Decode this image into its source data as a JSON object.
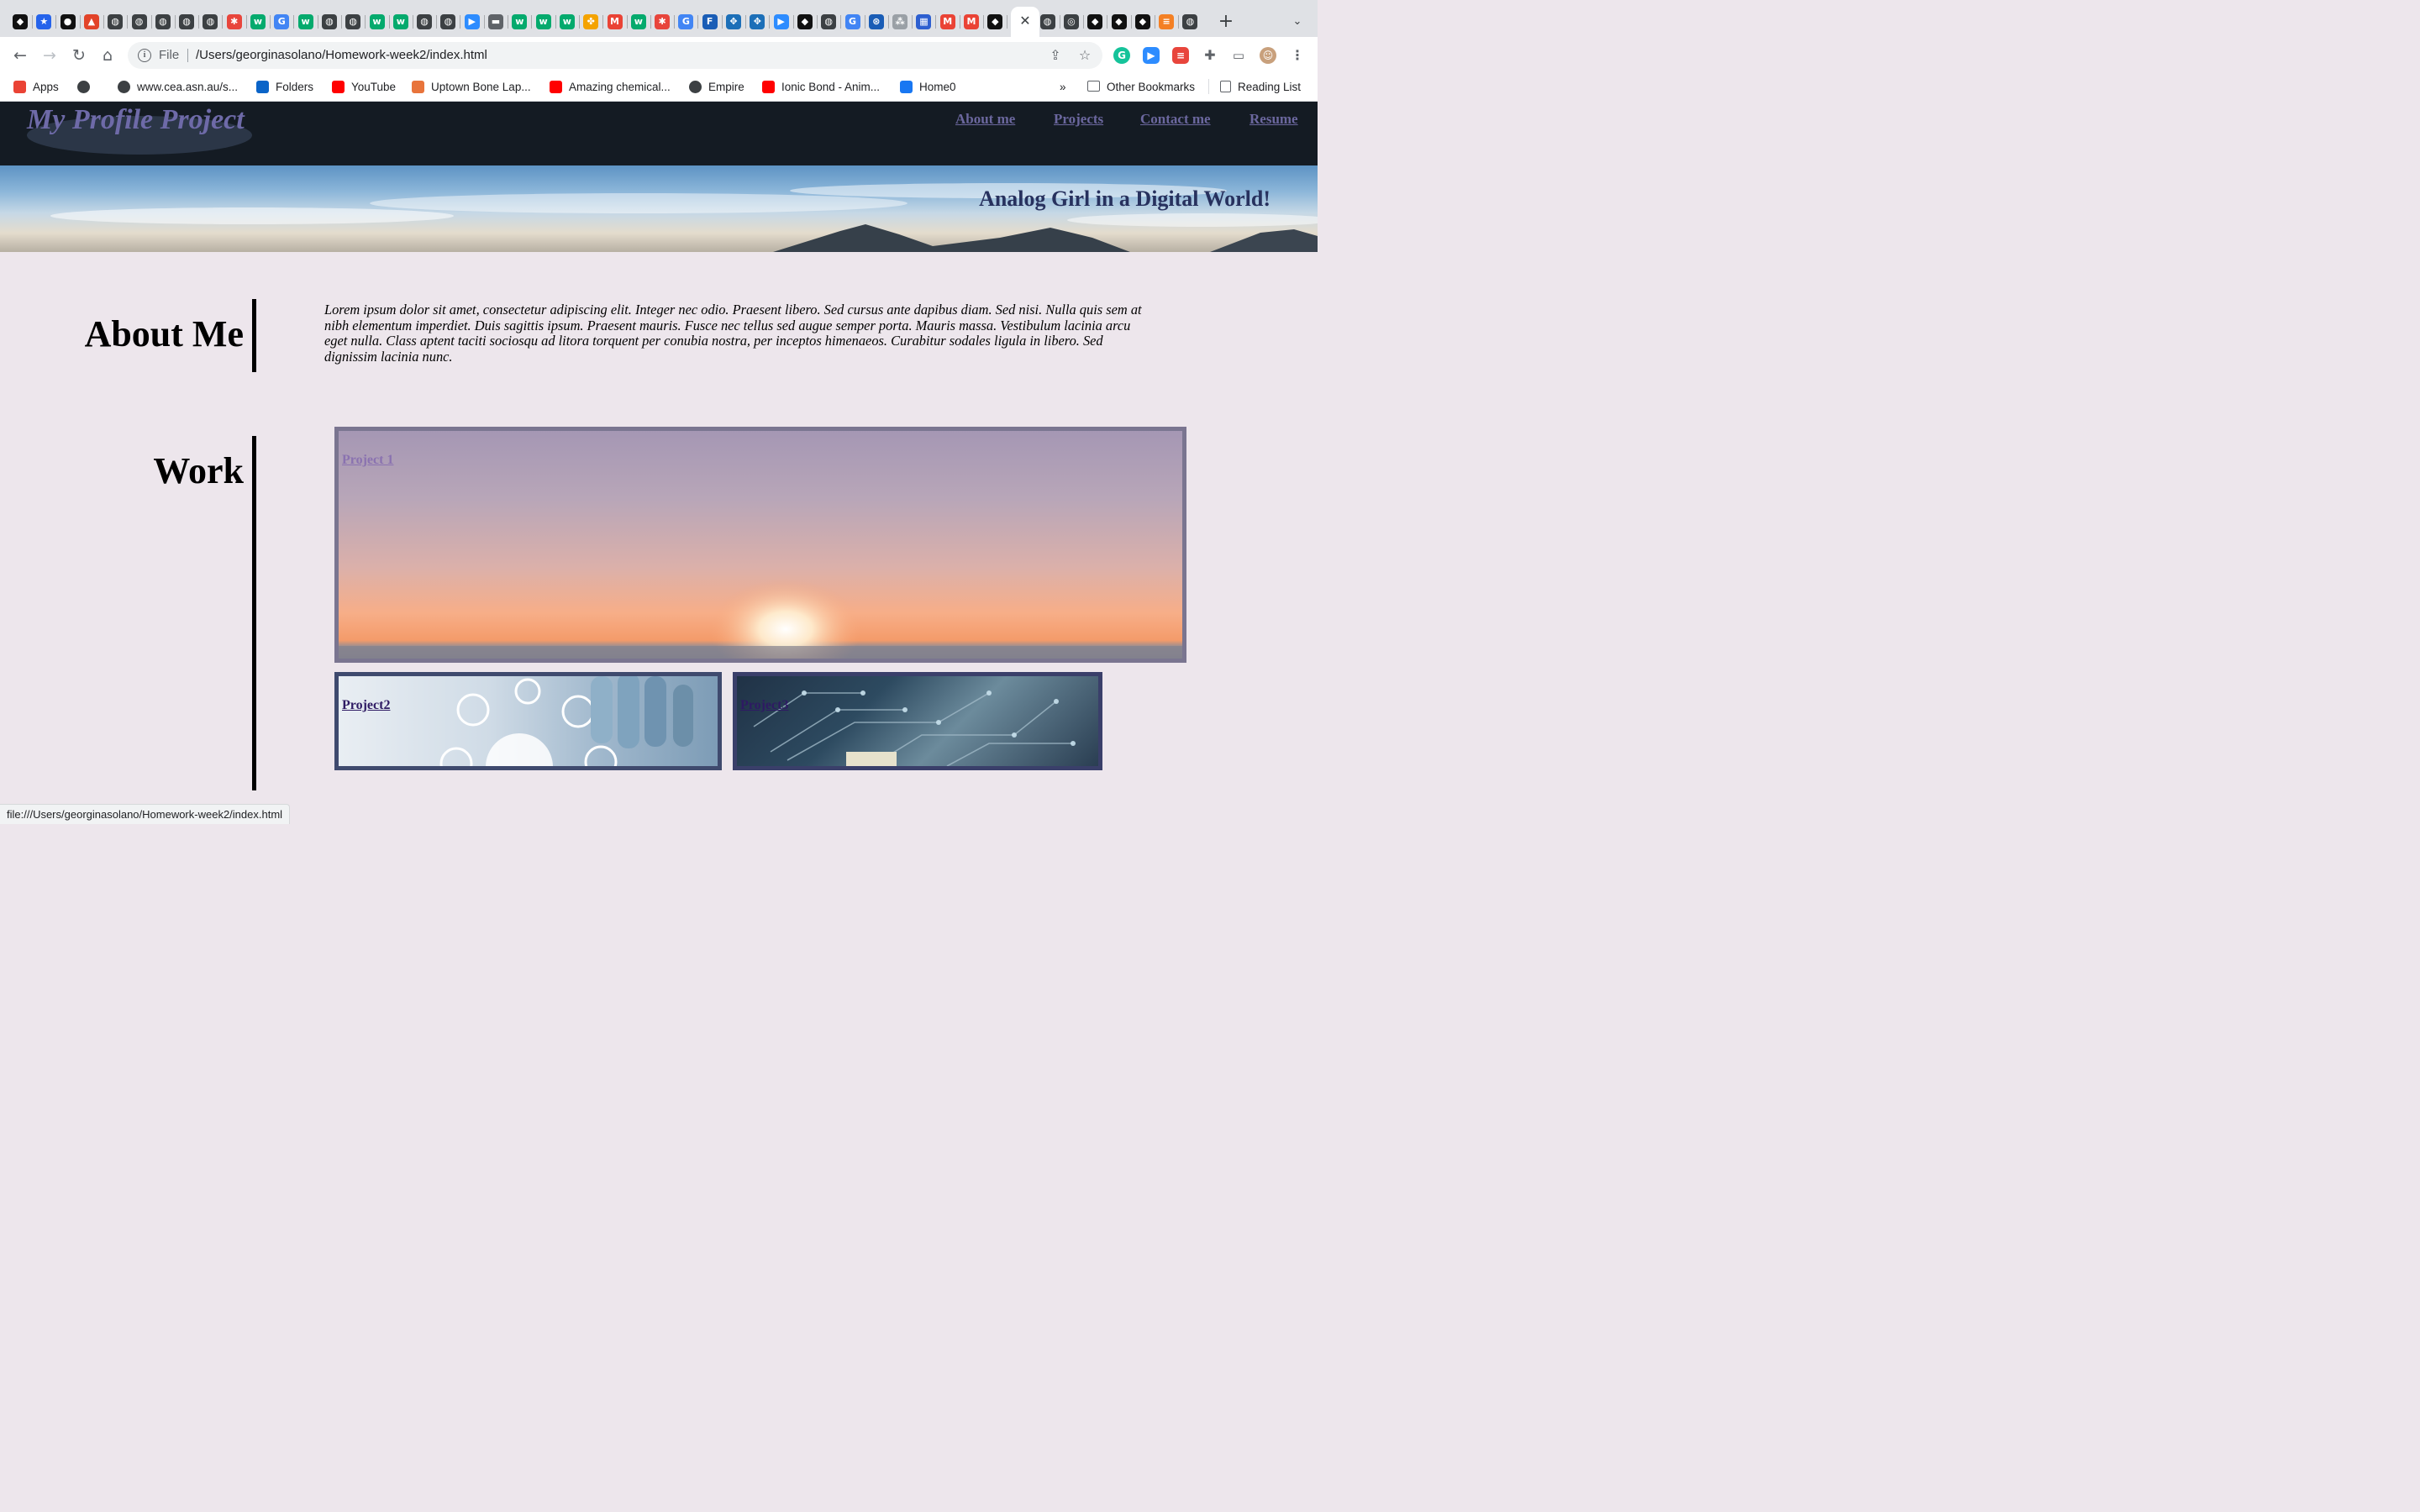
{
  "browser": {
    "tabs_favicons": [
      {
        "icon": "github-pages-icon",
        "color": "#111111",
        "glyph": "◆"
      },
      {
        "icon": "star-icon",
        "color": "#2563eb",
        "glyph": "★"
      },
      {
        "icon": "github-icon",
        "color": "#111111",
        "glyph": "●"
      },
      {
        "icon": "gitlab-icon",
        "color": "#e24329",
        "glyph": "▲"
      },
      {
        "icon": "globe-icon",
        "color": "#3c4043",
        "glyph": "◍"
      },
      {
        "icon": "globe-icon",
        "color": "#3c4043",
        "glyph": "◍"
      },
      {
        "icon": "globe-icon",
        "color": "#3c4043",
        "glyph": "◍"
      },
      {
        "icon": "globe-icon",
        "color": "#3c4043",
        "glyph": "◍"
      },
      {
        "icon": "globe-icon",
        "color": "#3c4043",
        "glyph": "◍"
      },
      {
        "icon": "asterisk-icon",
        "color": "#e8453c",
        "glyph": "✱"
      },
      {
        "icon": "w3schools-icon",
        "color": "#04aa6d",
        "glyph": "w"
      },
      {
        "icon": "google-icon",
        "color": "#4285f4",
        "glyph": "G"
      },
      {
        "icon": "w3schools-icon",
        "color": "#04aa6d",
        "glyph": "w"
      },
      {
        "icon": "globe-icon",
        "color": "#3c4043",
        "glyph": "◍"
      },
      {
        "icon": "globe-icon",
        "color": "#3c4043",
        "glyph": "◍"
      },
      {
        "icon": "w3schools-icon",
        "color": "#04aa6d",
        "glyph": "w"
      },
      {
        "icon": "w3schools-icon",
        "color": "#04aa6d",
        "glyph": "w"
      },
      {
        "icon": "globe-icon",
        "color": "#3c4043",
        "glyph": "◍"
      },
      {
        "icon": "globe-icon",
        "color": "#3c4043",
        "glyph": "◍"
      },
      {
        "icon": "zoom-icon",
        "color": "#2d8cff",
        "glyph": "▶"
      },
      {
        "icon": "folder-icon",
        "color": "#5f6368",
        "glyph": "▬"
      },
      {
        "icon": "w3schools-icon",
        "color": "#04aa6d",
        "glyph": "w"
      },
      {
        "icon": "w3schools-icon",
        "color": "#04aa6d",
        "glyph": "w"
      },
      {
        "icon": "w3schools-icon",
        "color": "#04aa6d",
        "glyph": "w"
      },
      {
        "icon": "pinwheel-icon",
        "color": "#f4a300",
        "glyph": "✤"
      },
      {
        "icon": "gmail-icon",
        "color": "#ea4335",
        "glyph": "M"
      },
      {
        "icon": "w3schools-icon",
        "color": "#04aa6d",
        "glyph": "w"
      },
      {
        "icon": "asterisk-icon",
        "color": "#e8453c",
        "glyph": "✱"
      },
      {
        "icon": "google-icon",
        "color": "#4285f4",
        "glyph": "G"
      },
      {
        "icon": "fx-icon",
        "color": "#1a5db6",
        "glyph": "F"
      },
      {
        "icon": "trinity-icon",
        "color": "#1c6fb8",
        "glyph": "✥"
      },
      {
        "icon": "trinity-icon",
        "color": "#1c6fb8",
        "glyph": "✥"
      },
      {
        "icon": "zoom-icon",
        "color": "#2d8cff",
        "glyph": "▶"
      },
      {
        "icon": "github-pages-icon",
        "color": "#111111",
        "glyph": "◆"
      },
      {
        "icon": "globe-icon",
        "color": "#3c4043",
        "glyph": "◍"
      },
      {
        "icon": "google-icon",
        "color": "#4285f4",
        "glyph": "G"
      },
      {
        "icon": "atom-icon",
        "color": "#1a5db6",
        "glyph": "⊛"
      },
      {
        "icon": "network-icon",
        "color": "#9aa0a6",
        "glyph": "⁂"
      },
      {
        "icon": "calendar-icon",
        "color": "#2d5fd0",
        "glyph": "▦"
      },
      {
        "icon": "gmail-icon",
        "color": "#ea4335",
        "glyph": "M"
      },
      {
        "icon": "gmail-icon",
        "color": "#ea4335",
        "glyph": "M"
      },
      {
        "icon": "github-pages-icon",
        "color": "#111111",
        "glyph": "◆"
      },
      {
        "icon": "globe-icon",
        "color": "#3c4043",
        "glyph": "◍"
      },
      {
        "icon": "chrome-icon",
        "color": "#3c4043",
        "glyph": "◎"
      },
      {
        "icon": "github-pages-icon",
        "color": "#111111",
        "glyph": "◆"
      },
      {
        "icon": "github-pages-icon",
        "color": "#111111",
        "glyph": "◆"
      },
      {
        "icon": "github-pages-icon",
        "color": "#111111",
        "glyph": "◆"
      },
      {
        "icon": "stack-overflow-icon",
        "color": "#f48024",
        "glyph": "≡"
      },
      {
        "icon": "globe-icon",
        "color": "#3c4043",
        "glyph": "◍"
      }
    ],
    "url_scheme": "File",
    "url": "/Users/georginasolano/Homework-week2/index.html",
    "bookmarks": [
      {
        "label": "Apps",
        "icon": "apps-grid-icon",
        "color": "#ea4335"
      },
      {
        "label": "",
        "icon": "globe-icon",
        "color": "#3c4043"
      },
      {
        "label": "www.cea.asn.au/s...",
        "icon": "globe-icon",
        "color": "#3c4043"
      },
      {
        "label": "Folders",
        "icon": "outlook-icon",
        "color": "#0a64c8"
      },
      {
        "label": "YouTube",
        "icon": "youtube-icon",
        "color": "#ff0000"
      },
      {
        "label": "Uptown Bone Lap...",
        "icon": "tsp-icon",
        "color": "#e8743b"
      },
      {
        "label": "Amazing chemical...",
        "icon": "youtube-icon",
        "color": "#ff0000"
      },
      {
        "label": "Empire",
        "icon": "globe-icon",
        "color": "#3c4043"
      },
      {
        "label": "Ionic Bond - Anim...",
        "icon": "youtube-icon",
        "color": "#ff0000"
      },
      {
        "label": "Home0",
        "icon": "facebook-icon",
        "color": "#1877f2"
      }
    ],
    "bookmarks_more": "»",
    "other_bookmarks": "Other Bookmarks",
    "reading_list": "Reading List",
    "status_url": "file:///Users/georginasolano/Homework-week2/index.html"
  },
  "site": {
    "logo": "My Profile Project",
    "nav": [
      "About me",
      "Projects",
      "Contact me",
      "Resume"
    ],
    "hero_title": "Analog Girl in a Digital World!",
    "about_heading": "About Me",
    "about_text": "Lorem ipsum dolor sit amet, consectetur adipiscing elit. Integer nec odio. Praesent libero. Sed cursus ante dapibus diam. Sed nisi. Nulla quis sem at nibh elementum imperdiet. Duis sagittis ipsum. Praesent mauris. Fusce nec tellus sed augue semper porta. Mauris massa. Vestibulum lacinia arcu eget nulla. Class aptent taciti sociosqu ad litora torquent per conubia nostra, per inceptos himenaeos. Curabitur sodales ligula in libero. Sed dignissim lacinia nunc.",
    "work_heading": "Work",
    "projects": [
      "Project 1",
      "Project2",
      "Project3"
    ]
  },
  "colors": {
    "page_bg": "#ede6ec",
    "header_bg": "#141b23",
    "nav_link": "#6b679e",
    "hero_title": "#27315e",
    "project_border": "#3f4a6e"
  }
}
